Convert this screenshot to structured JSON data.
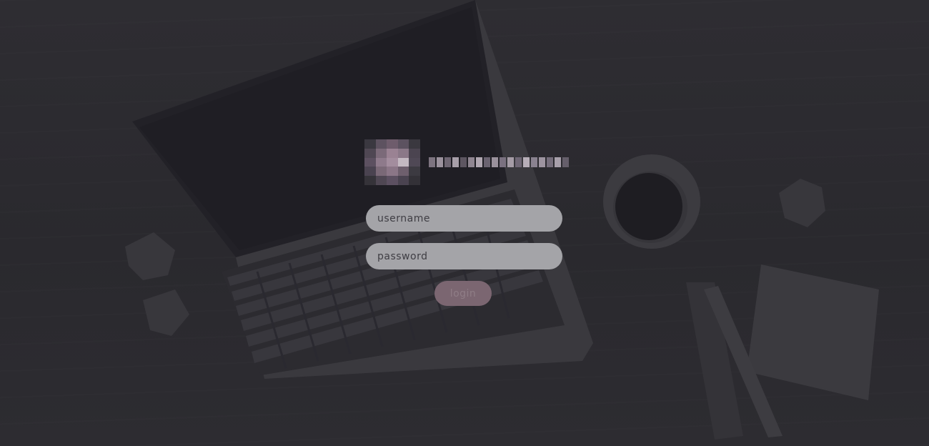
{
  "login": {
    "username_placeholder": "username",
    "password_placeholder": "password",
    "button_label": "login"
  },
  "logo": {
    "icon": "pixelated-logo-mark",
    "text_obscured": true
  },
  "colors": {
    "background": "#2b2a2f",
    "input_fill": "#a4a4a8",
    "button_fill": "#7b6671",
    "button_text": "#8f7d86",
    "logo_accent": "#9a8291"
  }
}
